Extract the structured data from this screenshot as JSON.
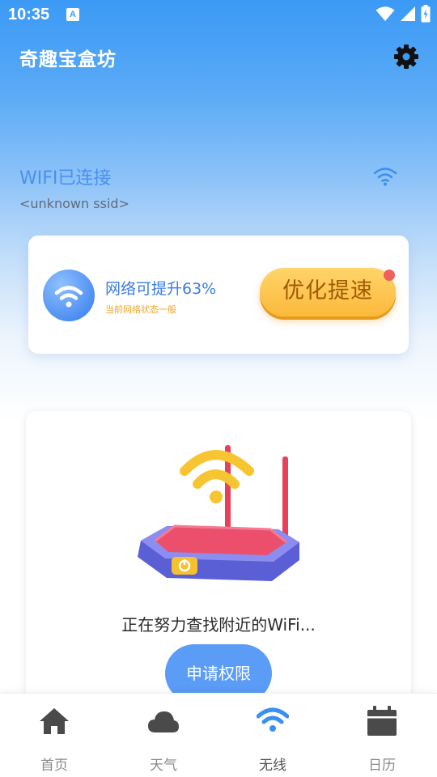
{
  "status_bar": {
    "time": "10:35",
    "notification_badge": "A"
  },
  "header": {
    "title": "奇趣宝盒坊",
    "settings_icon": "gear-icon"
  },
  "wifi": {
    "status": "WIFI已连接",
    "ssid": "<unknown ssid>"
  },
  "boost_card": {
    "title": "网络可提升63%",
    "subtitle": "当前网络状态一般",
    "button_label": "优化提速"
  },
  "scan_card": {
    "message": "正在努力查找附近的WiFi...",
    "button_label": "申请权限"
  },
  "bottom_nav": {
    "items": [
      {
        "label": "首页",
        "icon": "home-icon"
      },
      {
        "label": "天气",
        "icon": "cloud-icon"
      },
      {
        "label": "无线",
        "icon": "wifi-icon",
        "active": true
      },
      {
        "label": "日历",
        "icon": "calendar-icon"
      }
    ]
  },
  "colors": {
    "primary_blue": "#3b9af5",
    "accent_orange": "#fbb93a",
    "active_tab": "#3b8ff0",
    "inactive_tab": "#4a4a4a"
  }
}
